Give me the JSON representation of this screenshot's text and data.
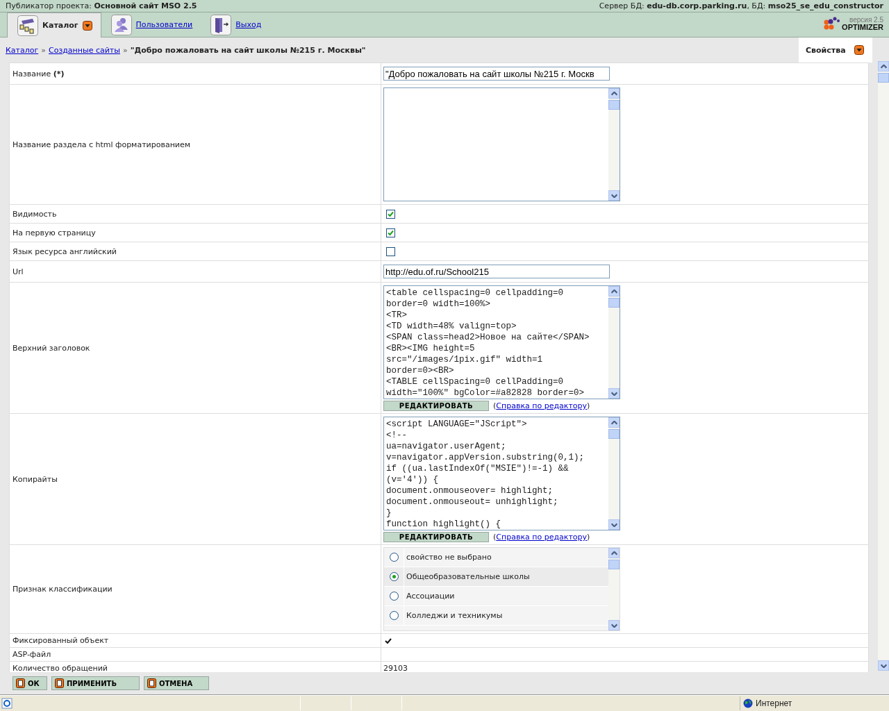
{
  "header": {
    "project_label": "Публикатор проекта:",
    "project_name": "Основной сайт MSO 2.5",
    "server_label": "Сервер БД:",
    "server": "edu-db.corp.parking.ru",
    "db_label": ", БД:",
    "db": "mso25_se_edu_constructor"
  },
  "nav": [
    {
      "label": "Каталог",
      "selected": true,
      "dropdown": true
    },
    {
      "label": "Пользователи",
      "selected": false,
      "dropdown": false
    },
    {
      "label": "Выход",
      "selected": false,
      "dropdown": false
    }
  ],
  "logo": {
    "version": "версия 2.5",
    "name": "OPTIMIZER"
  },
  "breadcrumb": [
    {
      "label": "Каталог",
      "kind": "link"
    },
    {
      "label": "Созданные сайты",
      "kind": "link"
    },
    {
      "label": "\"Добро пожаловать на сайт школы №215 г. Москвы\"",
      "kind": "current"
    }
  ],
  "separator": "»",
  "properties_menu": {
    "label": "Свойства"
  },
  "fields": [
    {
      "kind": "text",
      "label": "Название **(*)**",
      "value": "\"Добро пожаловать на сайт школы №215 г. Москв"
    },
    {
      "kind": "textarea",
      "label": "Название раздела с html форматированием"
    },
    {
      "kind": "checkbox",
      "label": "Видимость",
      "checked": true
    },
    {
      "kind": "checkbox",
      "label": "На первую страницу",
      "checked": true
    },
    {
      "kind": "checkbox",
      "label": "Язык ресурса английский",
      "checked": false
    },
    {
      "kind": "text",
      "label": "Url",
      "value": "http://edu.of.ru/School215"
    },
    {
      "kind": "code",
      "label": "Верхний заголовок",
      "lines": [
        "<table cellspacing=0 cellpadding=0",
        "border=0 width=100%>",
        "<TR>",
        "<TD width=48% valign=top>",
        "<SPAN class=head2>Новое на сайте</SPAN>",
        "<BR><IMG height=5",
        "src=\"/images/1pix.gif\" width=1",
        "border=0><BR>",
        "<TABLE cellSpacing=0 cellPadding=0",
        "width=\"100%\" bgColor=#a82828 border=0>"
      ],
      "button": "РЕДАКТИРОВАТЬ",
      "help": {
        "open": "(",
        "link": "Справка по редактору",
        "close": ")"
      }
    },
    {
      "kind": "code",
      "label": "Копирайты",
      "lines": [
        "<script LANGUAGE=\"JScript\">",
        "<!--",
        "ua=navigator.userAgent;",
        "v=navigator.appVersion.substring(0,1);",
        "if ((ua.lastIndexOf(\"MSIE\")!=-1) &&",
        "(v='4')) {",
        "document.onmouseover= highlight;",
        "document.onmouseout= unhighlight;",
        "}",
        "function highlight() {"
      ],
      "button": "РЕДАКТИРОВАТЬ",
      "help": {
        "open": "(",
        "link": "Справка по редактору",
        "close": ")"
      }
    },
    {
      "kind": "radio",
      "label": "Признак классификации",
      "options": [
        {
          "label": "свойство не выбрано",
          "selected": false
        },
        {
          "label": "Общеобразовательные школы",
          "selected": true
        },
        {
          "label": "Ассоциации",
          "selected": false
        },
        {
          "label": "Колледжи и техникумы",
          "selected": false
        }
      ]
    },
    {
      "kind": "tick",
      "label": "Фиксированный объект",
      "checked": true
    },
    {
      "kind": "static",
      "label": "ASP-файл"
    },
    {
      "kind": "static",
      "label": "Количество обращений",
      "value": "29103"
    }
  ],
  "buttons": [
    "ОК",
    "ПРИМЕНИТЬ",
    "ОТМЕНА"
  ],
  "status_bar": {
    "zone": "Интернет"
  }
}
